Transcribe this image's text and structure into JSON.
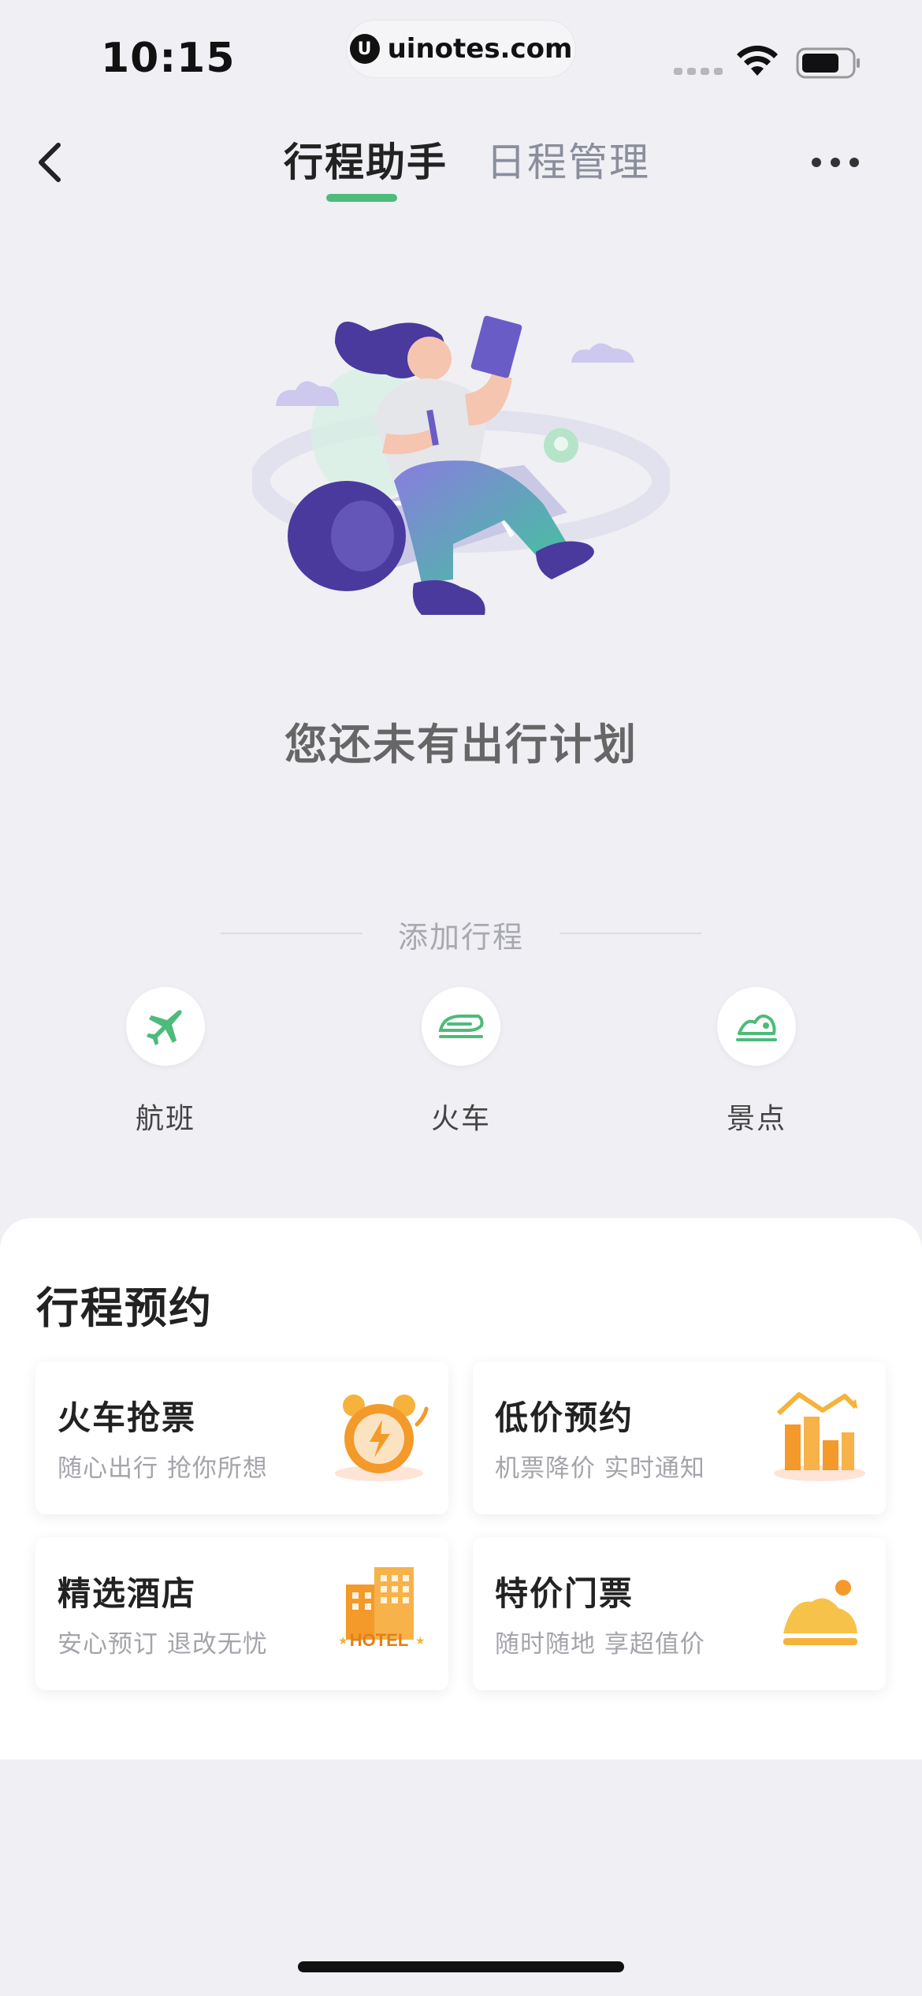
{
  "status_bar": {
    "time": "10:15",
    "url": "uinotes.com",
    "url_logo": "U"
  },
  "nav": {
    "tabs": [
      {
        "label": "行程助手",
        "active": true
      },
      {
        "label": "日程管理",
        "active": false
      }
    ],
    "accent_color": "#4dbb7a"
  },
  "empty_state": {
    "message": "您还未有出行计划"
  },
  "add_trip": {
    "title": "添加行程",
    "options": [
      {
        "label": "航班",
        "icon": "airplane-icon"
      },
      {
        "label": "火车",
        "icon": "train-icon"
      },
      {
        "label": "景点",
        "icon": "attraction-icon"
      }
    ]
  },
  "booking": {
    "title": "行程预约",
    "cards": [
      {
        "title": "火车抢票",
        "subtitle": "随心出行 抢你所想",
        "icon": "alarm-clock-icon"
      },
      {
        "title": "低价预约",
        "subtitle": "机票降价 实时通知",
        "icon": "price-drop-chart-icon"
      },
      {
        "title": "精选酒店",
        "subtitle": "安心预订 退改无忧",
        "icon": "hotel-icon",
        "icon_text": "HOTEL"
      },
      {
        "title": "特价门票",
        "subtitle": "随时随地 享超值价",
        "icon": "mountain-sun-icon"
      }
    ]
  }
}
